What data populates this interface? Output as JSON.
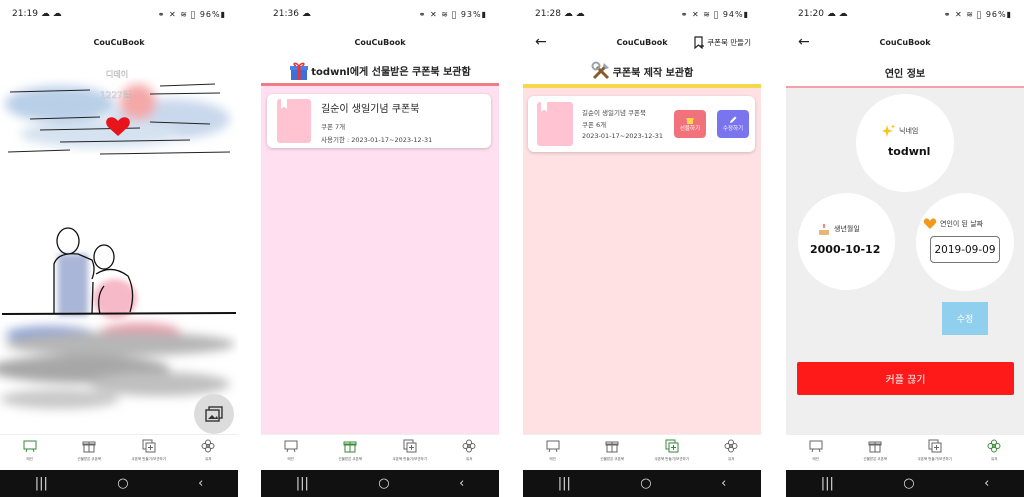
{
  "app_title": "CouCuBook",
  "bottom_nav": [
    {
      "label": "메인",
      "icon": "easel-icon"
    },
    {
      "label": "선물받은 쿠폰북",
      "icon": "gift-icon"
    },
    {
      "label": "쿠폰북 만들기/보관하기",
      "icon": "add-coupon-icon"
    },
    {
      "label": "유저",
      "icon": "flower-icon"
    }
  ],
  "system_nav": {
    "recent": "|||",
    "home": "○",
    "back": "‹"
  },
  "screens": {
    "main": {
      "time": "21:19",
      "status_left": "☁ ☁",
      "status_right": "⚭ ✕ ≋ ⃠ 96%▮",
      "dday_label": "디데이",
      "dday_value": "1227일",
      "fab_icon": "gallery-icon"
    },
    "received": {
      "time": "21:36",
      "status_left": "☁",
      "status_right": "⚭ ✕ ≋ ⃠ 93%▮",
      "heading": "todwnl에게 선물받은 쿠폰북 보관함",
      "heading_icon": "gift-box-icon",
      "coupon": {
        "title": "길순이 생일기념 쿠폰북",
        "count": "쿠폰 7개",
        "period": "사용기한 : 2023-01-17~2023-12-31"
      }
    },
    "created": {
      "time": "21:28",
      "status_left": "☁ ☁",
      "status_right": "⚭ ✕ ≋ ⃠ 94%▮",
      "create_action": "쿠폰북 만들기",
      "heading": "쿠폰북 제작 보관함",
      "heading_icon": "tools-icon",
      "coupon": {
        "title": "길순이 생일기념 쿠폰북",
        "count": "쿠폰 6개",
        "period": "2023-01-17~2023-12-31"
      },
      "gift_button": "선물하기",
      "edit_button": "수정하기"
    },
    "partner": {
      "time": "21:20",
      "status_left": "☁ ☁",
      "status_right": "⚭ ✕ ≋ ⃠ 96%▮",
      "heading": "연인 정보",
      "nickname_label": "닉네임",
      "nickname": "todwnl",
      "birthday_label": "생년월일",
      "birthday": "2000-10-12",
      "anniversary_label": "연인이 된 날짜",
      "anniversary": "2019-09-09",
      "edit_button": "수정",
      "breakup_button": "커플 끊기"
    }
  },
  "colors": {
    "pink_bg": "#ffdff0",
    "salmon_bg": "#ffe1e4",
    "gray_bg": "#efefef",
    "red_button": "#ff1a1a",
    "edit_blue": "#90cfee"
  }
}
